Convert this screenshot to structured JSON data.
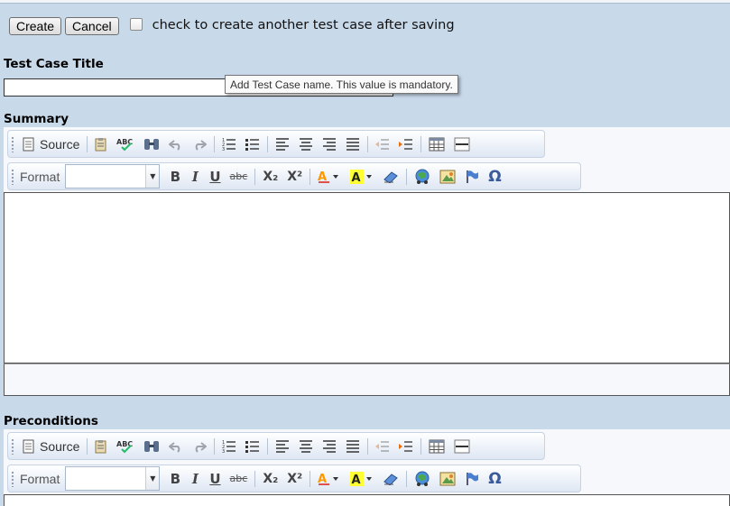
{
  "actions": {
    "create_label": "Create",
    "cancel_label": "Cancel",
    "checkbox_label": "check to create another test case after saving"
  },
  "title_field": {
    "label": "Test Case Title",
    "value": "",
    "tooltip": "Add Test Case name. This value is mandatory."
  },
  "toolbar": {
    "source_label": "Source",
    "format_label": "Format",
    "format_value": "",
    "bold": "B",
    "italic": "I",
    "underline": "U",
    "strike": "abc",
    "subscript": "X₂",
    "superscript": "X²",
    "omega": "Ω",
    "icons": [
      "source-icon",
      "paste-icon",
      "spellcheck-icon",
      "find-icon",
      "undo-icon",
      "redo-icon",
      "numbered-list-icon",
      "bulleted-list-icon",
      "align-left-icon",
      "align-center-icon",
      "align-right-icon",
      "justify-icon",
      "outdent-icon",
      "indent-icon",
      "table-icon",
      "horizontal-rule-icon",
      "text-color-icon",
      "background-color-icon",
      "eraser-icon",
      "link-icon",
      "image-icon",
      "flag-icon",
      "special-char-icon"
    ]
  },
  "sections": [
    {
      "label": "Summary",
      "content": ""
    },
    {
      "label": "Preconditions",
      "content": ""
    }
  ],
  "colors": {
    "page_bg": "#c8d9ea",
    "toolbar_bg": "#e8eef7",
    "text_color_a": "#ff9900",
    "highlight_yellow": "#ffff33"
  }
}
